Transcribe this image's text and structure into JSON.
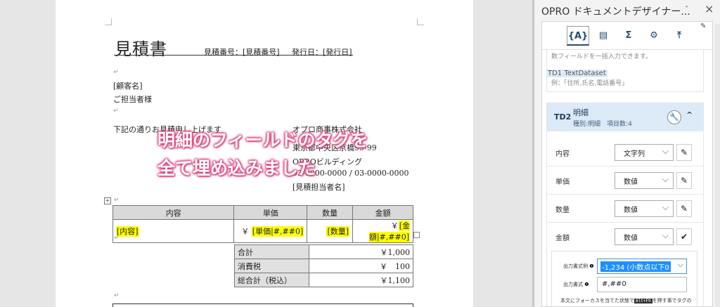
{
  "document": {
    "title": "見積書",
    "estimate_number": "見積番号：[見積番号]",
    "issue_date": "発行日：[発行日]",
    "customer_name": "[顧客名]",
    "contact_person": "ご担当者様",
    "intro": "下記の通りお見積申し上げます",
    "company_name": "オプロ商事株式会社",
    "address": "東京都中央区京橋99-99",
    "building": "OPROビルディング",
    "phone": "03-0000-0000 / 03-0000-0000",
    "rep": "[見積担当者名]",
    "para_mark": "↵",
    "banner_line1": "明細のフィールドのタグを",
    "banner_line2": "全て埋め込みました",
    "detail_table": {
      "headers": [
        "内容",
        "単価",
        "数量",
        "金額"
      ],
      "row": {
        "content": "[内容]",
        "price_yen": "￥",
        "price": "[単価|#,##0]",
        "qty": "[数量]",
        "amount_yen": "￥",
        "amount": "[金額|#,##0]"
      }
    },
    "totals": [
      {
        "label": "合計",
        "value": "￥1,000"
      },
      {
        "label": "消費税",
        "value": "￥　100"
      },
      {
        "label": "総合計（税込）",
        "value": "￥1,100"
      }
    ]
  },
  "pane": {
    "title": "OPRO ドキュメントデザイナー...",
    "toolbar": [
      {
        "name": "field-tab",
        "glyph": "{A}"
      },
      {
        "name": "table-tab",
        "glyph": "▤"
      },
      {
        "name": "sum-tab",
        "glyph": "Σ"
      },
      {
        "name": "settings-tab",
        "glyph": "⚙"
      },
      {
        "name": "upload-tab",
        "glyph": "⤒"
      }
    ],
    "prev_ghost_1": "数フィールドを一括入力できます。",
    "prev_ghost_2": "例：「住所,氏名,電話番号」",
    "td1_label": "TD1 TextDataset",
    "card": {
      "id": "TD2",
      "name": "明細",
      "meta": "種別:明細　項目数:4",
      "fields": [
        {
          "label": "内容",
          "type": "文字列"
        },
        {
          "label": "単価",
          "type": "数値"
        },
        {
          "label": "数量",
          "type": "数値"
        },
        {
          "label": "金額",
          "type": "数値"
        }
      ],
      "format_example_label": "出力書式例",
      "format_example_value": "-1,234 (小数点以下0",
      "format_label": "出力書式",
      "format_value": "#,##0",
      "note_pre": "本文にフォーカスを当てた状態で",
      "note_key": "Alt+F9",
      "note_post": "を押す事でタグの表示を切り替える事ができます。"
    }
  }
}
